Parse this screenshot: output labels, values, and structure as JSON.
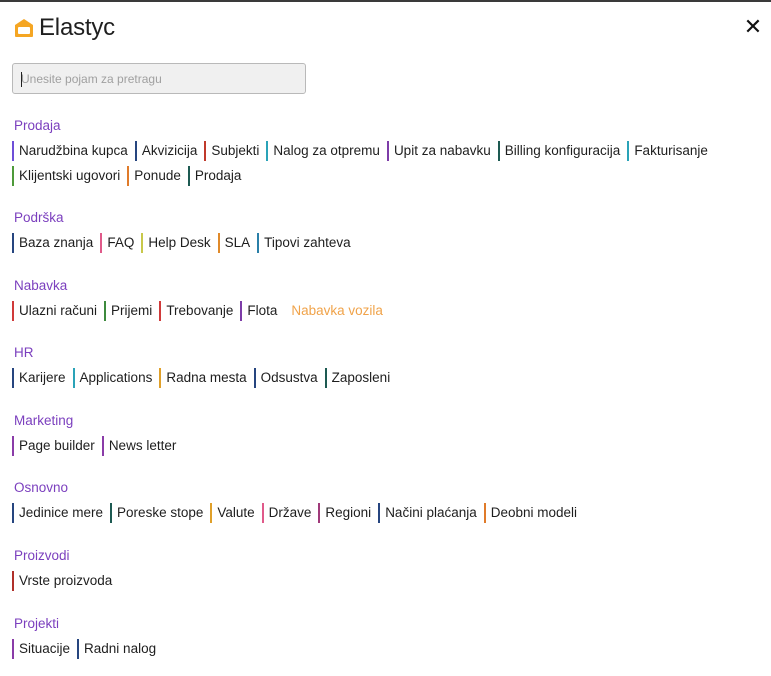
{
  "app": {
    "logo_text": "Elastyc",
    "logo_color": "#f5a623",
    "close_icon": "close-icon"
  },
  "search": {
    "placeholder": "Unesite pojam za pretragu",
    "value": ""
  },
  "sections": [
    {
      "title": "Prodaja",
      "items": [
        {
          "label": "Narudžbina kupca",
          "color": "#6e4fd8"
        },
        {
          "label": "Akvizicija",
          "color": "#26457f"
        },
        {
          "label": "Subjekti",
          "color": "#c0392b"
        },
        {
          "label": "Nalog za otpremu",
          "color": "#2aa3b8"
        },
        {
          "label": "Upit za nabavku",
          "color": "#7d3ca8"
        },
        {
          "label": "Billing konfiguracija",
          "color": "#1d5a52"
        },
        {
          "label": "Fakturisanje",
          "color": "#2aa3b8"
        },
        {
          "label": "Klijentski ugovori",
          "color": "#4e9a3a"
        },
        {
          "label": "Ponude",
          "color": "#e07b2a"
        },
        {
          "label": "Prodaja",
          "color": "#1d5a52"
        }
      ]
    },
    {
      "title": "Podrška",
      "items": [
        {
          "label": "Baza znanja",
          "color": "#26457f"
        },
        {
          "label": "FAQ",
          "color": "#e05a8a"
        },
        {
          "label": "Help Desk",
          "color": "#c8c84a"
        },
        {
          "label": "SLA",
          "color": "#e08a2a"
        },
        {
          "label": "Tipovi zahteva",
          "color": "#2a7fa8"
        }
      ]
    },
    {
      "title": "Nabavka",
      "items": [
        {
          "label": "Ulazni računi",
          "color": "#d03a3a"
        },
        {
          "label": "Prijemi",
          "color": "#3d8a3d"
        },
        {
          "label": "Trebovanje",
          "color": "#d03a3a"
        },
        {
          "label": "Flota",
          "color": "#7d3ca8"
        },
        {
          "label": "Nabavka vozila",
          "color": "#ffffff",
          "highlight": true
        }
      ]
    },
    {
      "title": "HR",
      "items": [
        {
          "label": "Karijere",
          "color": "#26457f"
        },
        {
          "label": "Applications",
          "color": "#2aa3b8"
        },
        {
          "label": "Radna mesta",
          "color": "#e0a02a"
        },
        {
          "label": "Odsustva",
          "color": "#26457f"
        },
        {
          "label": "Zaposleni",
          "color": "#1d5a52"
        }
      ]
    },
    {
      "title": "Marketing",
      "items": [
        {
          "label": "Page builder",
          "color": "#8a3ca8"
        },
        {
          "label": "News letter",
          "color": "#8a3ca8"
        }
      ]
    },
    {
      "title": "Osnovno",
      "items": [
        {
          "label": "Jedinice mere",
          "color": "#26457f"
        },
        {
          "label": "Poreske stope",
          "color": "#1d5a52"
        },
        {
          "label": "Valute",
          "color": "#e0a02a"
        },
        {
          "label": "Države",
          "color": "#e05a8a"
        },
        {
          "label": "Regioni",
          "color": "#a03a7a"
        },
        {
          "label": "Načini plaćanja",
          "color": "#26457f"
        },
        {
          "label": "Deobni modeli",
          "color": "#e07b2a"
        }
      ]
    },
    {
      "title": "Proizvodi",
      "items": [
        {
          "label": "Vrste proizvoda",
          "color": "#b0302a"
        }
      ]
    },
    {
      "title": "Projekti",
      "items": [
        {
          "label": "Situacije",
          "color": "#8a3ca8"
        },
        {
          "label": "Radni nalog",
          "color": "#26457f"
        }
      ]
    }
  ]
}
